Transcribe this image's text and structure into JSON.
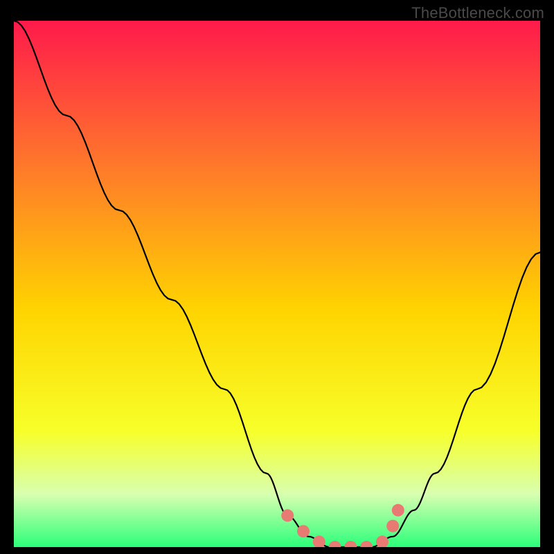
{
  "watermark": "TheBottleneck.com",
  "colors": {
    "gradient_top": "#ff1a4b",
    "gradient_mid_upper": "#ff7a2a",
    "gradient_mid": "#ffd400",
    "gradient_mid_lower": "#f7ff2a",
    "gradient_green_pale": "#d8ffb0",
    "gradient_green": "#2bff7a",
    "curve": "#000000",
    "marker": "#e77a72",
    "background": "#000000"
  },
  "chart_data": {
    "type": "line",
    "title": "",
    "xlabel": "",
    "ylabel": "",
    "xlim": [
      0,
      100
    ],
    "ylim": [
      0,
      100
    ],
    "annotations": [],
    "series": [
      {
        "name": "bottleneck-curve",
        "x": [
          0,
          10,
          20,
          30,
          40,
          48,
          52,
          56,
          60,
          64,
          68,
          72,
          76,
          80,
          88,
          100
        ],
        "y": [
          100,
          82,
          64,
          47,
          30,
          14,
          6,
          2,
          0,
          0,
          0,
          2,
          7,
          14,
          30,
          56
        ]
      }
    ],
    "markers": {
      "name": "highlight-points",
      "x": [
        52,
        55,
        58,
        61,
        64,
        67,
        70,
        72,
        73
      ],
      "y": [
        6,
        3,
        1,
        0,
        0,
        0,
        1,
        4,
        7
      ]
    }
  }
}
